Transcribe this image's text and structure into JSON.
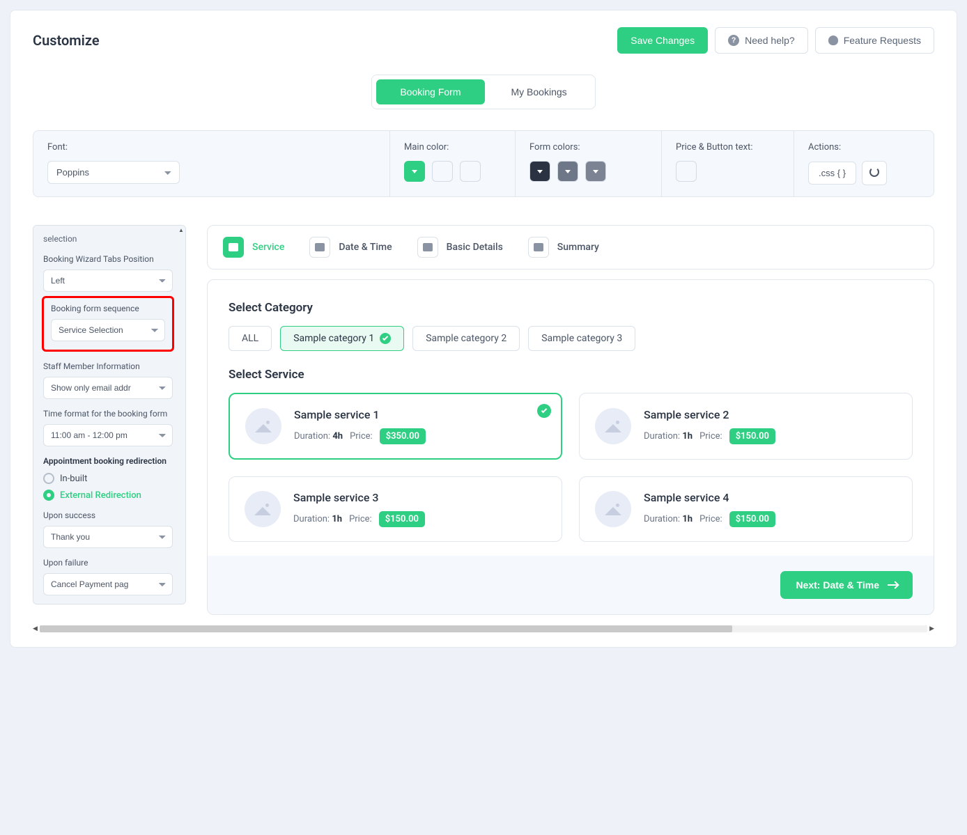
{
  "header": {
    "title": "Customize",
    "save": "Save Changes",
    "help": "Need help?",
    "feature": "Feature Requests"
  },
  "topTabs": {
    "booking": "Booking Form",
    "myBookings": "My Bookings"
  },
  "settings": {
    "fontLabel": "Font:",
    "fontValue": "Poppins",
    "mainColorLabel": "Main color:",
    "formColorsLabel": "Form colors:",
    "priceBtnLabel": "Price & Button text:",
    "actionsLabel": "Actions:",
    "cssBtn": ".css { }",
    "mainColors": {
      "primary": "#2fcf83"
    },
    "formColors": {
      "dark": "#2b3343",
      "mid1": "#6e7787",
      "mid2": "#7c8494"
    }
  },
  "sidebar": {
    "truncated": "selection",
    "tabsPosLabel": "Booking Wizard Tabs Position",
    "tabsPosValue": "Left",
    "seqLabel": "Booking form sequence",
    "seqValue": "Service Selection",
    "staffLabel": "Staff Member Information",
    "staffValue": "Show only email addr",
    "timeLabel": "Time format for the booking form",
    "timeValue": "11:00 am - 12:00 pm",
    "redirHeading": "Appointment booking redirection",
    "radioInbuilt": "In-built",
    "radioExternal": "External Redirection",
    "successLabel": "Upon success",
    "successValue": "Thank you",
    "failureLabel": "Upon failure",
    "failureValue": "Cancel Payment pag"
  },
  "steps": [
    {
      "label": "Service",
      "active": true
    },
    {
      "label": "Date & Time",
      "active": false
    },
    {
      "label": "Basic Details",
      "active": false
    },
    {
      "label": "Summary",
      "active": false
    }
  ],
  "preview": {
    "catTitle": "Select Category",
    "svcTitle": "Select Service",
    "categories": [
      {
        "label": "ALL",
        "active": false
      },
      {
        "label": "Sample category 1",
        "active": true
      },
      {
        "label": "Sample category 2",
        "active": false
      },
      {
        "label": "Sample category 3",
        "active": false
      }
    ],
    "durationWord": "Duration:",
    "priceWord": "Price:",
    "services": [
      {
        "name": "Sample service 1",
        "duration": "4h",
        "price": "$350.00",
        "selected": true
      },
      {
        "name": "Sample service 2",
        "duration": "1h",
        "price": "$150.00",
        "selected": false
      },
      {
        "name": "Sample service 3",
        "duration": "1h",
        "price": "$150.00",
        "selected": false
      },
      {
        "name": "Sample service 4",
        "duration": "1h",
        "price": "$150.00",
        "selected": false
      }
    ],
    "nextBtn": "Next: Date & Time"
  }
}
